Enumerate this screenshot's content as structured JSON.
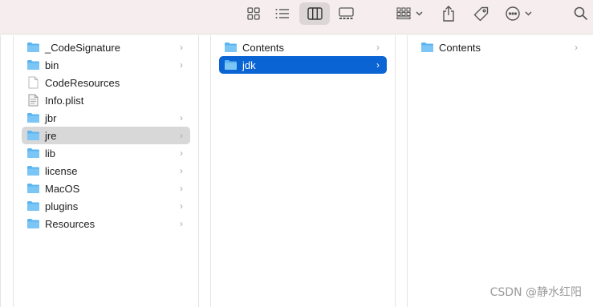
{
  "toolbar": {
    "buttons": [
      {
        "name": "icon-view-button",
        "icon": "grid-icon"
      },
      {
        "name": "list-view-button",
        "icon": "list-icon"
      },
      {
        "name": "column-view-button",
        "icon": "columns-icon",
        "active": true
      },
      {
        "name": "gallery-view-button",
        "icon": "gallery-icon"
      },
      {
        "name": "group-button",
        "icon": "group-grid-icon"
      },
      {
        "name": "share-button",
        "icon": "share-icon"
      },
      {
        "name": "tags-button",
        "icon": "tag-icon"
      },
      {
        "name": "more-actions-button",
        "icon": "ellipsis-circle-icon"
      },
      {
        "name": "search-button",
        "icon": "search-icon"
      }
    ]
  },
  "columns": [
    {
      "items": [
        {
          "label": "_CodeSignature",
          "kind": "folder",
          "chevron": true
        },
        {
          "label": "bin",
          "kind": "folder",
          "chevron": true
        },
        {
          "label": "CodeResources",
          "kind": "file",
          "chevron": false
        },
        {
          "label": "Info.plist",
          "kind": "plist",
          "chevron": false
        },
        {
          "label": "jbr",
          "kind": "folder",
          "chevron": true
        },
        {
          "label": "jre",
          "kind": "folder",
          "chevron": true,
          "state": "gray"
        },
        {
          "label": "lib",
          "kind": "folder",
          "chevron": true
        },
        {
          "label": "license",
          "kind": "folder",
          "chevron": true
        },
        {
          "label": "MacOS",
          "kind": "folder",
          "chevron": true
        },
        {
          "label": "plugins",
          "kind": "folder",
          "chevron": true
        },
        {
          "label": "Resources",
          "kind": "folder",
          "chevron": true
        }
      ]
    },
    {
      "items": [
        {
          "label": "Contents",
          "kind": "folder",
          "chevron": true
        },
        {
          "label": "jdk",
          "kind": "folder",
          "chevron": true,
          "state": "blue"
        }
      ]
    },
    {
      "items": [
        {
          "label": "Contents",
          "kind": "folder",
          "chevron": true
        }
      ]
    }
  ],
  "colors": {
    "toolbar_bg": "#f6eeee",
    "folder": "#5ab4f0",
    "selection_blue": "#0a64d3",
    "selection_gray": "#d8d8d8"
  },
  "watermark": "CSDN @静水红阳"
}
